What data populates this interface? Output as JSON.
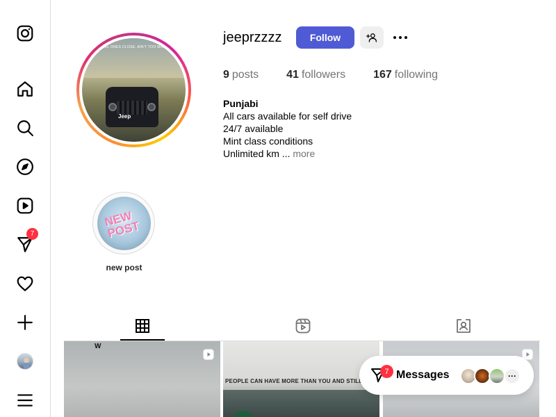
{
  "sidebar": {
    "items": [
      {
        "name": "instagram-logo-icon",
        "label": "Instagram"
      },
      {
        "name": "home-icon",
        "label": "Home"
      },
      {
        "name": "search-icon",
        "label": "Search"
      },
      {
        "name": "explore-icon",
        "label": "Explore"
      },
      {
        "name": "reels-icon",
        "label": "Reels"
      },
      {
        "name": "messages-icon",
        "label": "Messages",
        "badge": "7"
      },
      {
        "name": "notifications-icon",
        "label": "Notifications"
      },
      {
        "name": "create-icon",
        "label": "Create"
      },
      {
        "name": "profile-avatar",
        "label": "Profile"
      },
      {
        "name": "menu-icon",
        "label": "More"
      }
    ]
  },
  "profile": {
    "username": "jeeprzzzz",
    "follow_label": "Follow",
    "stats": {
      "posts_count": "9",
      "posts_label": "posts",
      "followers_count": "41",
      "followers_label": "followers",
      "following_count": "167",
      "following_label": "following"
    },
    "bio": {
      "name": "Punjabi ",
      "lines": [
        "All cars available for self drive",
        "24/7 available",
        "Mint class conditions",
        "Unlimited km ..."
      ],
      "more_label": "more"
    },
    "picture_caption": "REAL ONES CLOSE. AIN'T TOO MANY",
    "picture_brand": "Jeep"
  },
  "highlights": [
    {
      "label": "new post",
      "image_text": "NEW POST"
    }
  ],
  "tabs": [
    {
      "name": "posts-grid-icon",
      "active": true
    },
    {
      "name": "reels-tab-icon",
      "active": false
    },
    {
      "name": "tagged-icon",
      "active": false
    }
  ],
  "grid": [
    {
      "overlay_text": "W",
      "type": "reel"
    },
    {
      "overlay_text": "PEOPLE CAN HAVE MORE THAN YOU AND STILL BE JEA",
      "type": "post"
    },
    {
      "overlay_text": "",
      "type": "reel"
    }
  ],
  "messages_bar": {
    "label": "Messages",
    "badge": "7",
    "more_label": "···"
  },
  "colors": {
    "accent": "#4f5bd5",
    "badge": "#ff3040",
    "border": "#dbdbdb",
    "muted": "#737373"
  }
}
